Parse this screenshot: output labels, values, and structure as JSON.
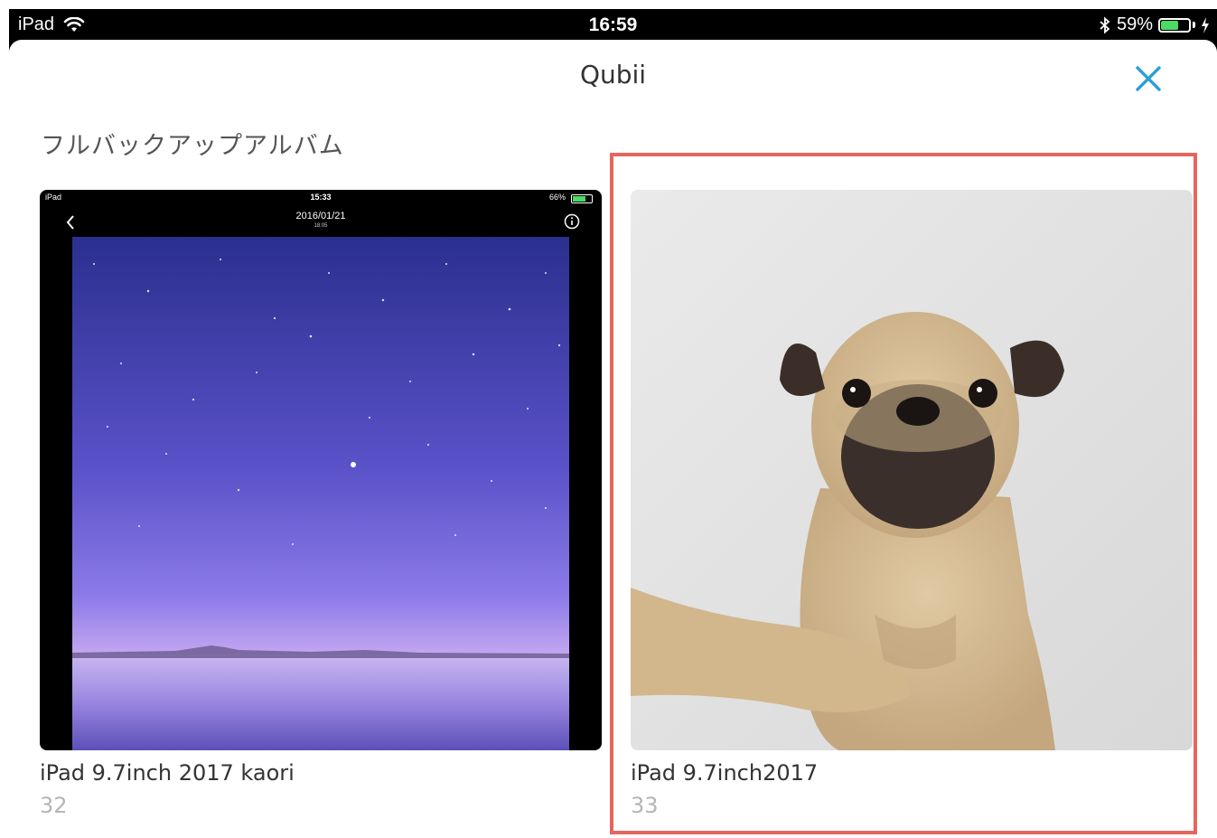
{
  "status_bar": {
    "device": "iPad",
    "time": "16:59",
    "battery_percent": "59%",
    "battery_level": 0.59,
    "icons": [
      "wifi-icon",
      "bluetooth-icon",
      "battery-icon",
      "charging-icon"
    ]
  },
  "nav": {
    "title": "Qubii",
    "close_icon": "close-icon"
  },
  "section": {
    "title": "フルバックアップアルバム"
  },
  "albums": [
    {
      "name": "iPad 9.7inch 2017 kaori",
      "count": "32",
      "thumbnail": {
        "status_time": "15:33",
        "status_device": "iPad",
        "status_battery": "66%",
        "date": "2016/01/21",
        "date_sub": "18:05",
        "description": "screenshot-starry-sky"
      }
    },
    {
      "name": "iPad 9.7inch2017",
      "count": "33",
      "thumbnail": {
        "description": "pug-photo"
      }
    }
  ],
  "colors": {
    "accent": "#2a9fd6",
    "highlight": "#e4665e",
    "battery": "#4cd964"
  }
}
